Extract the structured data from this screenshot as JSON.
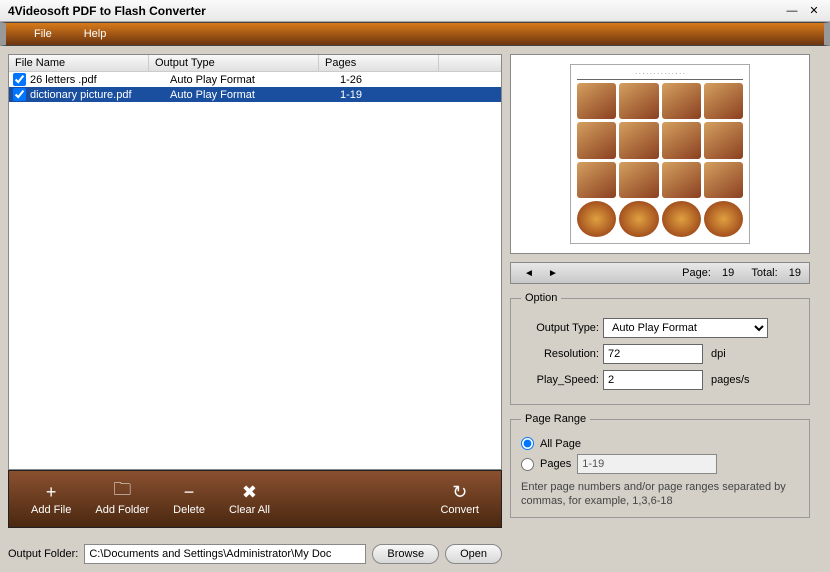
{
  "window": {
    "title": "4Videosoft PDF to Flash Converter"
  },
  "menu": {
    "file": "File",
    "help": "Help"
  },
  "columns": {
    "name": "File Name",
    "type": "Output Type",
    "pages": "Pages"
  },
  "files": [
    {
      "name": "26 letters .pdf",
      "type": "Auto Play Format",
      "pages": "1-26",
      "checked": true,
      "selected": false
    },
    {
      "name": "dictionary picture.pdf",
      "type": "Auto Play Format",
      "pages": "1-19",
      "checked": true,
      "selected": true
    }
  ],
  "toolbar": {
    "addFile": "Add File",
    "addFolder": "Add Folder",
    "delete": "Delete",
    "clearAll": "Clear All",
    "convert": "Convert"
  },
  "output": {
    "label": "Output Folder:",
    "path": "C:\\Documents and Settings\\Administrator\\My Doc",
    "browse": "Browse",
    "open": "Open"
  },
  "nav": {
    "pageLabel": "Page:",
    "pageValue": "19",
    "totalLabel": "Total:",
    "totalValue": "19"
  },
  "option": {
    "legend": "Option",
    "outputTypeLabel": "Output Type:",
    "outputTypeValue": "Auto Play Format",
    "resolutionLabel": "Resolution:",
    "resolutionValue": "72",
    "resolutionUnit": "dpi",
    "speedLabel": "Play_Speed:",
    "speedValue": "2",
    "speedUnit": "pages/s"
  },
  "pageRange": {
    "legend": "Page Range",
    "allPage": "All Page",
    "pages": "Pages",
    "pagesValue": "1-19",
    "hint": "Enter page numbers and/or page ranges separated by commas, for example, 1,3,6-18"
  }
}
